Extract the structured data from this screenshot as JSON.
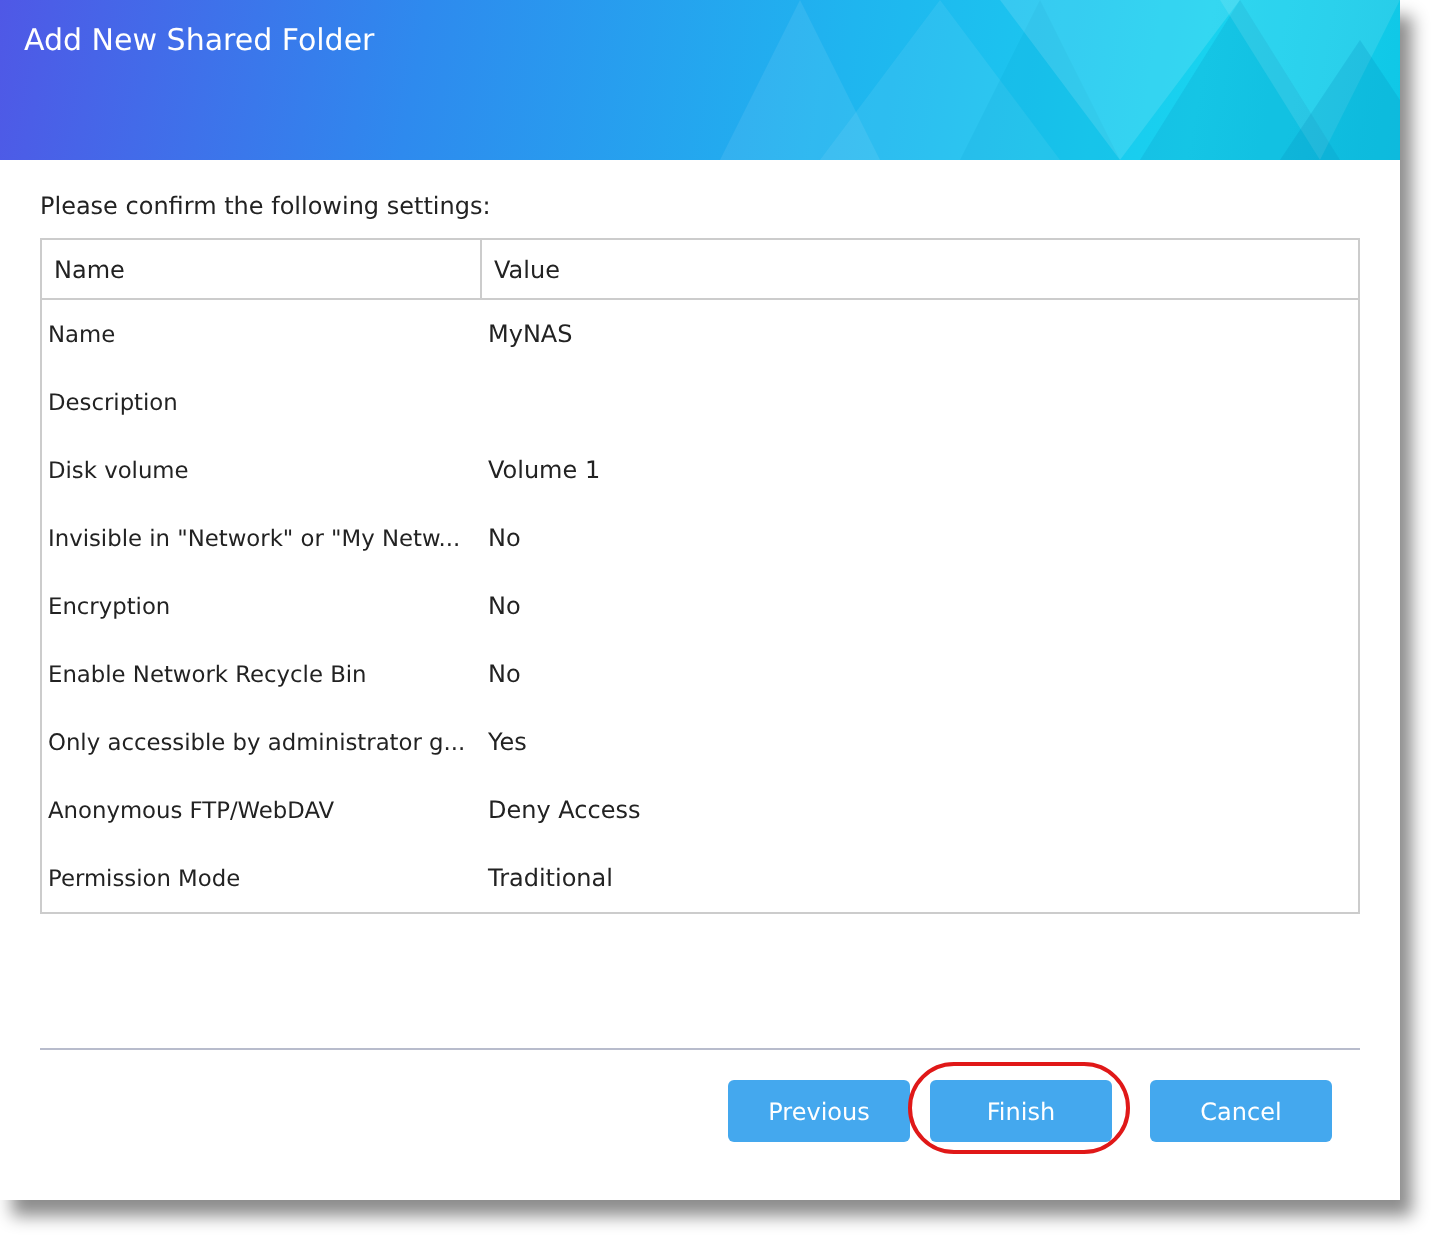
{
  "window": {
    "title": "Add New Shared Folder"
  },
  "prompt": "Please confirm the following settings:",
  "table": {
    "columns": [
      "Name",
      "Value"
    ],
    "rows": [
      {
        "name": "Name",
        "value": "MyNAS"
      },
      {
        "name": "Description",
        "value": ""
      },
      {
        "name": "Disk volume",
        "value": "Volume 1"
      },
      {
        "name": "Invisible in \"Network\" or \"My Netw...",
        "value": "No"
      },
      {
        "name": "Encryption",
        "value": "No"
      },
      {
        "name": "Enable Network Recycle Bin",
        "value": "No"
      },
      {
        "name": "Only accessible by administrator g...",
        "value": "Yes"
      },
      {
        "name": "Anonymous FTP/WebDAV",
        "value": "Deny Access"
      },
      {
        "name": "Permission Mode",
        "value": "Traditional"
      }
    ]
  },
  "buttons": [
    {
      "label": "Previous",
      "highlighted": false
    },
    {
      "label": "Finish",
      "highlighted": true
    },
    {
      "label": "Cancel",
      "highlighted": false
    }
  ]
}
